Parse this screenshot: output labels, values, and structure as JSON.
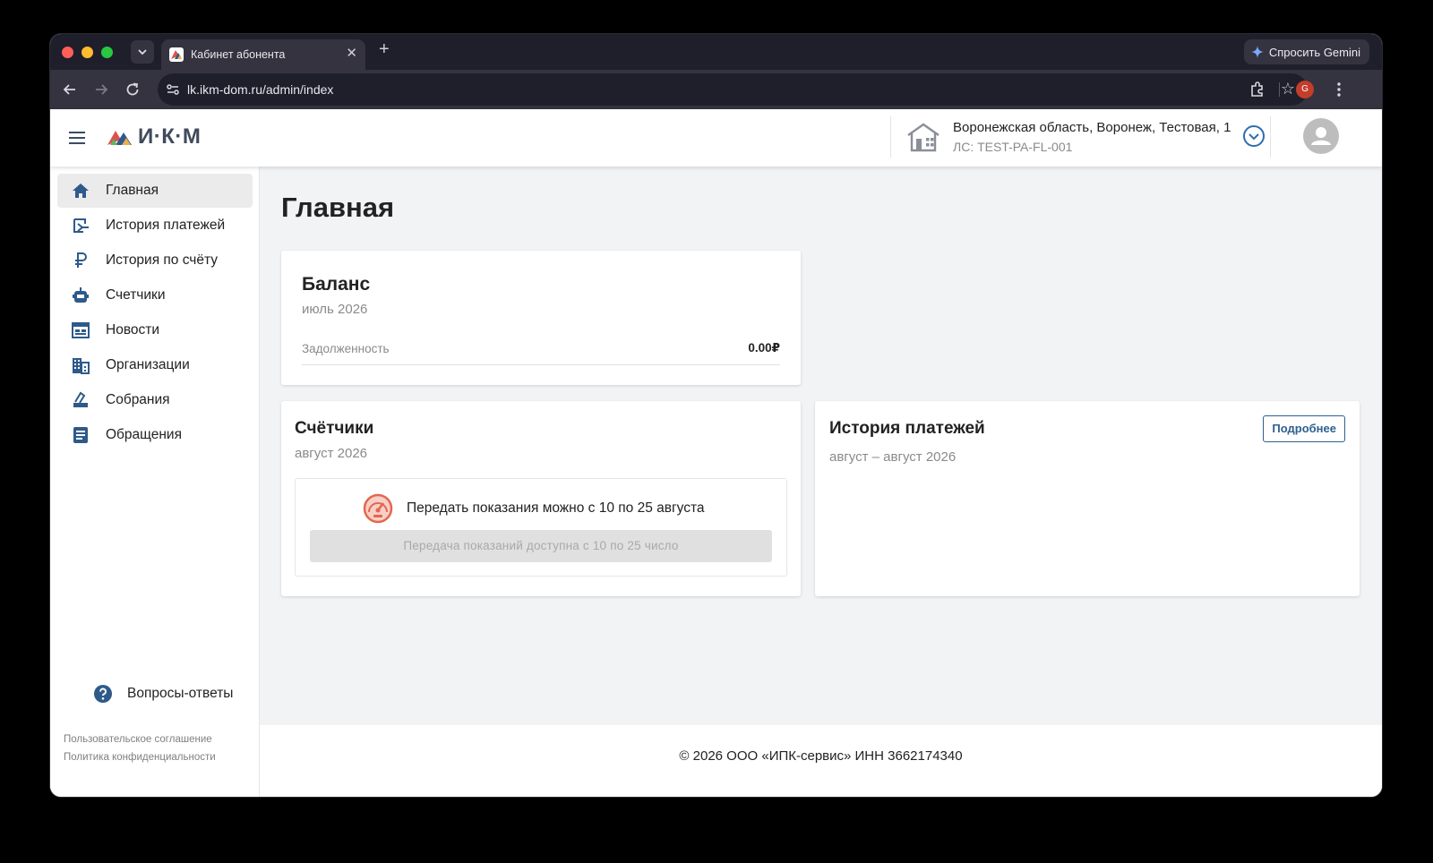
{
  "browser": {
    "tab_title": "Кабинет абонента",
    "tab_close": "✕",
    "new_tab": "+",
    "gemini_label": "Спросить Gemini",
    "url": "lk.ikm-dom.ru/admin/index",
    "star": "☆",
    "profile_initial": "G"
  },
  "header": {
    "logo_text": "И·К·М",
    "address": "Воронежская область, Воронеж, Тестовая, 1",
    "account": "ЛС: TEST-PA-FL-001"
  },
  "sidebar": {
    "items": [
      {
        "label": "Главная",
        "icon": "home-icon",
        "active": true
      },
      {
        "label": "История платежей",
        "icon": "payment-history-icon"
      },
      {
        "label": "История по счёту",
        "icon": "ruble-icon"
      },
      {
        "label": "Счетчики",
        "icon": "meter-icon"
      },
      {
        "label": "Новости",
        "icon": "news-icon"
      },
      {
        "label": "Организации",
        "icon": "organizations-icon"
      },
      {
        "label": "Собрания",
        "icon": "meetings-icon"
      },
      {
        "label": "Обращения",
        "icon": "requests-icon"
      }
    ],
    "faq_label": "Вопросы-ответы",
    "user_agreement": "Пользовательское соглашение",
    "privacy_policy": "Политика конфиденциальности"
  },
  "main": {
    "page_title": "Главная",
    "balance": {
      "title": "Баланс",
      "period": "июль 2026",
      "debt_label": "Задолженность",
      "debt_value": "0.00₽"
    },
    "meters": {
      "title": "Счётчики",
      "period": "август 2026",
      "note": "Передать показания можно с 10 по 25 августа",
      "button_label": "Передача показаний доступна с 10 по 25 число"
    },
    "payments": {
      "title": "История платежей",
      "period": "август – август 2026",
      "more_label": "Подробнее"
    }
  },
  "footer": {
    "text": "© 2026 ООО «ИПК-сервис» ИНН 3662174340"
  },
  "colors": {
    "accent": "#2f5f8f",
    "icon_blue": "#2e5a8a",
    "gauge": "#e2674f",
    "background": "#f2f3f5"
  }
}
